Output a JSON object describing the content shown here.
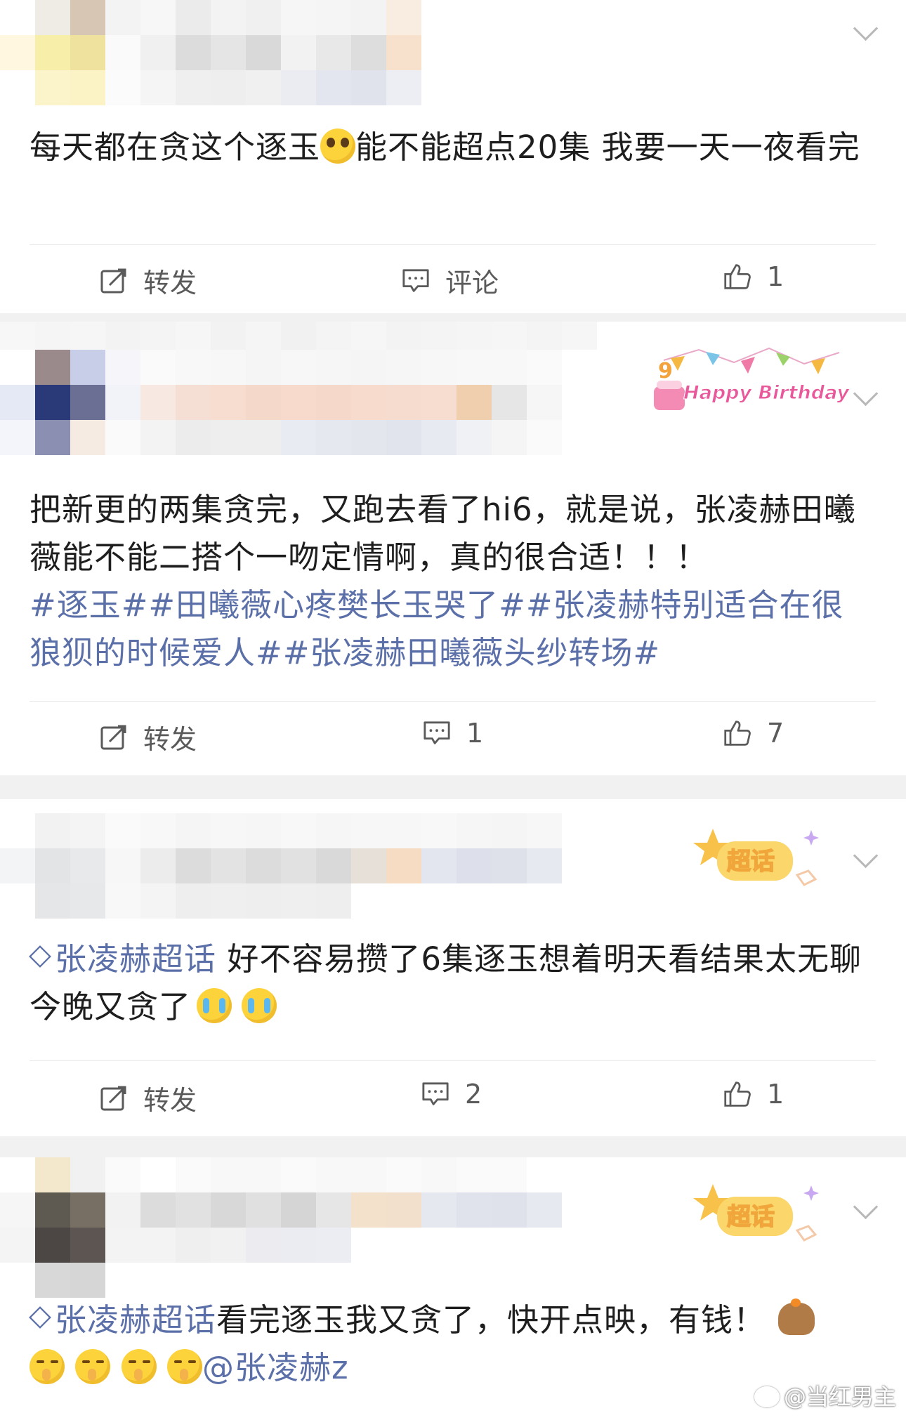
{
  "posts": [
    {
      "text": "每天都在贪这个逐玉",
      "emoji_1": "pleading-face",
      "text_2": "能不能超点20集 我要一天一夜看完",
      "actions": {
        "repost": "转发",
        "comment": "评论",
        "like": "1"
      }
    },
    {
      "badge": "Happy Birthday",
      "text": "把新更的两集贪完，又跑去看了hi6，就是说，张凌赫田曦薇能不能二搭个一吻定情啊，真的很合适！！！",
      "hashtags": "#逐玉##田曦薇心疼樊长玉哭了##张凌赫特别适合在很狼狈的时候爱人##张凌赫田曦薇头纱转场#",
      "actions": {
        "repost": "转发",
        "comment": "1",
        "like": "7"
      }
    },
    {
      "badge": "超话",
      "super_topic": "张凌赫超话",
      "text": " 好不容易攒了6集逐玉想着明天看结果太无聊今晚又贪了",
      "emoji": "loudly-crying-face",
      "actions": {
        "repost": "转发",
        "comment": "2",
        "like": "1"
      }
    },
    {
      "badge": "超话",
      "super_topic": "张凌赫超话",
      "text": "看完逐玉我又贪了，快开点映，有钱！",
      "emoji_1": "capybara",
      "emoji_2": "shushing-face",
      "mention": "@张凌赫z"
    }
  ],
  "watermark": "@当红男主",
  "colors": {
    "link": "#5b6fa8",
    "divider": "#e8e8e8",
    "gap": "#f1f1f1",
    "icon": "#5a5a5a"
  }
}
